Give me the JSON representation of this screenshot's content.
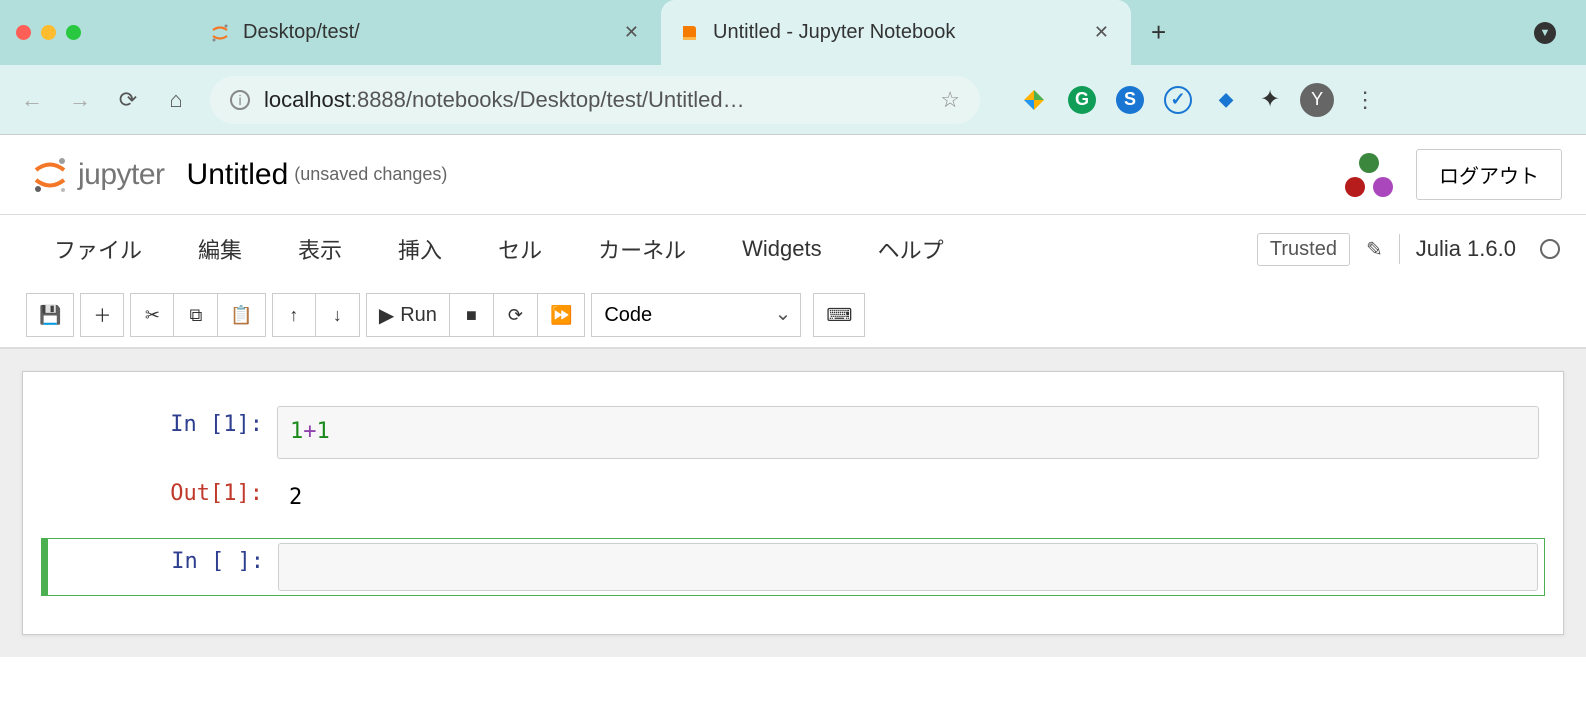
{
  "browser": {
    "tabs": [
      {
        "title": "Desktop/test/",
        "active": false,
        "icon": "jupyter-icon"
      },
      {
        "title": "Untitled - Jupyter Notebook",
        "active": true,
        "icon": "book-icon"
      }
    ],
    "url_display": "localhost:8888/notebooks/Desktop/test/Untitled…",
    "url_host": "localhost",
    "avatar_letter": "Y"
  },
  "header": {
    "logo_text": "jupyter",
    "notebook_name": "Untitled",
    "save_status": "(unsaved changes)",
    "logout_label": "ログアウト"
  },
  "menubar": {
    "items": [
      "ファイル",
      "編集",
      "表示",
      "挿入",
      "セル",
      "カーネル",
      "Widgets",
      "ヘルプ"
    ],
    "trusted_label": "Trusted",
    "kernel_name": "Julia 1.6.0"
  },
  "toolbar": {
    "run_label": "Run",
    "cell_type_selected": "Code"
  },
  "cells": [
    {
      "type": "code",
      "execution_count": 1,
      "in_prompt": "In [1]:",
      "out_prompt": "Out[1]:",
      "source_tokens": [
        {
          "t": "1",
          "cls": "num"
        },
        {
          "t": "+",
          "cls": "op"
        },
        {
          "t": "1",
          "cls": "num"
        }
      ],
      "output_text": "2",
      "selected": false
    },
    {
      "type": "code",
      "execution_count": null,
      "in_prompt": "In [ ]:",
      "source_tokens": [],
      "selected": true
    }
  ]
}
